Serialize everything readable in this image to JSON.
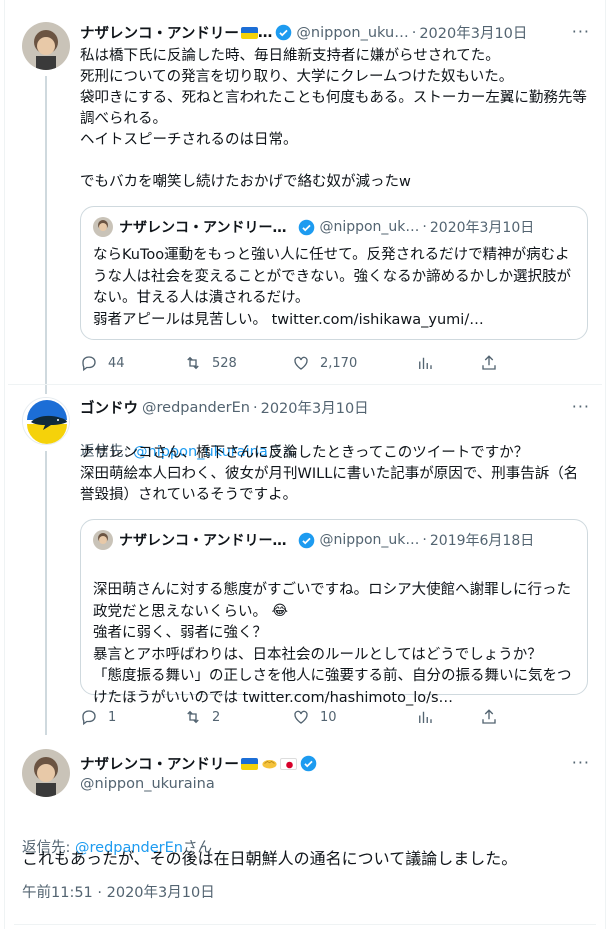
{
  "tweet1": {
    "name": "ナザレンコ・アンドリー",
    "name_suffix": "…",
    "handle": "@nippon_uku…",
    "time": "2020年3月10日",
    "text": "私は橋下氏に反論した時、毎日維新支持者に嫌がらせされてた。\n死刑についての発言を切り取り、大学にクレームつけた奴もいた。\n袋叩きにする、死ねと言われたことも何度もある。ストーカー左翼に勤務先等調べられる。\nヘイトスピーチされるのは日常。\n\nでもバカを嘲笑し続けたおかげで絡む奴が減ったw",
    "quote": {
      "name": "ナザレンコ・アンドリー…",
      "handle": "@nippon_uk…",
      "time": "2020年3月10日",
      "text": "ならKuToo運動をもっと強い人に任せて。反発されるだけで精神が病むような人は社会を変えることができない。強くなるか諦めるかしか選択肢がない。甘える人は潰されるだけ。\n弱者アピールは見苦しい。 twitter.com/ishikawa_yumi/…"
    },
    "replies": "44",
    "retweets": "528",
    "likes": "2,170"
  },
  "tweet2": {
    "name": "ゴンドウ",
    "handle": "@redpanderEn",
    "time": "2020年3月10日",
    "reply_prefix": "返信先: ",
    "reply_handle": "@nippon_ukuraina",
    "reply_suffix": "さん",
    "text": "ナザレンコさん、橋下さんに反論したときってこのツイートですか？\n深田萌絵本人曰わく、彼女が月刊WILLに書いた記事が原因で、刑事告訴（名誉毀損）されているそうですよ。",
    "quote": {
      "name": "ナザレンコ・アンドリー…",
      "handle": "@nippon_uk…",
      "time": "2019年6月18日",
      "text_line1": "深田萌さんに対する態度がすごいですね。ロシア大使館へ謝罪しに行った政党だと思えないくらい。",
      "emoji": "😂",
      "text_rest": "強者に弱く、弱者に強く？\n暴言とアホ呼ばわりは、日本社会のルールとしてはどうでしょうか？\n「態度振る舞い」の正しさを他人に強要する前、自分の振る舞いに気をつけたほうがいいのでは twitter.com/hashimoto_lo/s…"
    },
    "replies": "1",
    "retweets": "2",
    "likes": "10"
  },
  "tweet3": {
    "name": "ナザレンコ・アンドリー",
    "handle": "@nippon_ukuraina",
    "reply_prefix": "返信先: ",
    "reply_handle": "@redpanderEn",
    "reply_suffix": "さん",
    "text": "これもあったが、その後は在日朝鮮人の通名について議論しました。",
    "timestamp": "午前11:51 · 2020年3月10日"
  },
  "colors": {
    "accent": "#1d9bf0",
    "secondary_text": "#536471",
    "border": "#cfd9de"
  },
  "icons": [
    "reply-icon",
    "retweet-icon",
    "like-icon",
    "analytics-icon",
    "share-icon",
    "verified-icon",
    "more-icon"
  ]
}
